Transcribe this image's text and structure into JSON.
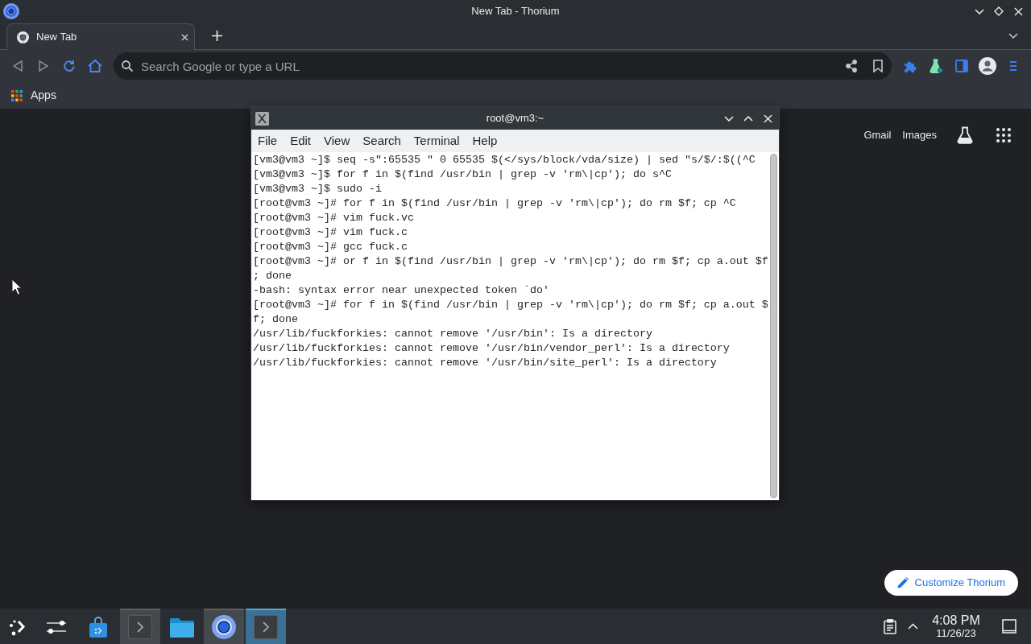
{
  "window": {
    "title": "New Tab - Thorium"
  },
  "tabs": [
    {
      "label": "New Tab",
      "selected": true
    }
  ],
  "toolbar": {
    "nav_buttons": [
      {
        "kind": "back",
        "disabled": true
      },
      {
        "kind": "forward",
        "disabled": true
      },
      {
        "kind": "reload",
        "disabled": false
      },
      {
        "kind": "home",
        "disabled": false
      }
    ],
    "address_bar": {
      "placeholder": "Search Google or type a URL"
    }
  },
  "bookmarks_bar": {
    "items": [
      {
        "label": "Apps"
      }
    ]
  },
  "new_tab_page": {
    "links": [
      "Gmail",
      "Images"
    ],
    "customize_button": "Customize Thorium"
  },
  "terminal": {
    "title": "root@vm3:~",
    "menu": [
      "File",
      "Edit",
      "View",
      "Search",
      "Terminal",
      "Help"
    ],
    "lines": [
      "[vm3@vm3 ~]$ seq -s\":65535 \" 0 65535 $(</sys/block/vda/size) | sed \"s/$/:$((^C",
      "[vm3@vm3 ~]$ for f in $(find /usr/bin | grep -v 'rm\\|cp'); do s^C",
      "[vm3@vm3 ~]$ sudo -i",
      "[root@vm3 ~]# for f in $(find /usr/bin | grep -v 'rm\\|cp'); do rm $f; cp ^C",
      "[root@vm3 ~]# vim fuck.vc",
      "[root@vm3 ~]# vim fuck.c",
      "[root@vm3 ~]# gcc fuck.c",
      "[root@vm3 ~]# or f in $(find /usr/bin | grep -v 'rm\\|cp'); do rm $f; cp a.out $f",
      "; done",
      "-bash: syntax error near unexpected token `do'",
      "[root@vm3 ~]# for f in $(find /usr/bin | grep -v 'rm\\|cp'); do rm $f; cp a.out $",
      "f; done",
      "/usr/lib/fuckforkies: cannot remove '/usr/bin': Is a directory",
      "/usr/lib/fuckforkies: cannot remove '/usr/bin/vendor_perl': Is a directory",
      "/usr/lib/fuckforkies: cannot remove '/usr/bin/site_perl': Is a directory"
    ]
  },
  "taskbar": {
    "items": [
      {
        "kind": "launcher",
        "running": false,
        "selected": false
      },
      {
        "kind": "settings",
        "running": false,
        "selected": false
      },
      {
        "kind": "store",
        "running": false,
        "selected": false
      },
      {
        "kind": "terminal",
        "running": true,
        "selected": false
      },
      {
        "kind": "files",
        "running": false,
        "selected": false
      },
      {
        "kind": "browser",
        "running": true,
        "selected": false
      },
      {
        "kind": "terminal",
        "running": true,
        "selected": true
      }
    ],
    "clock": {
      "time": "4:08 PM",
      "date": "11/26/23"
    }
  }
}
